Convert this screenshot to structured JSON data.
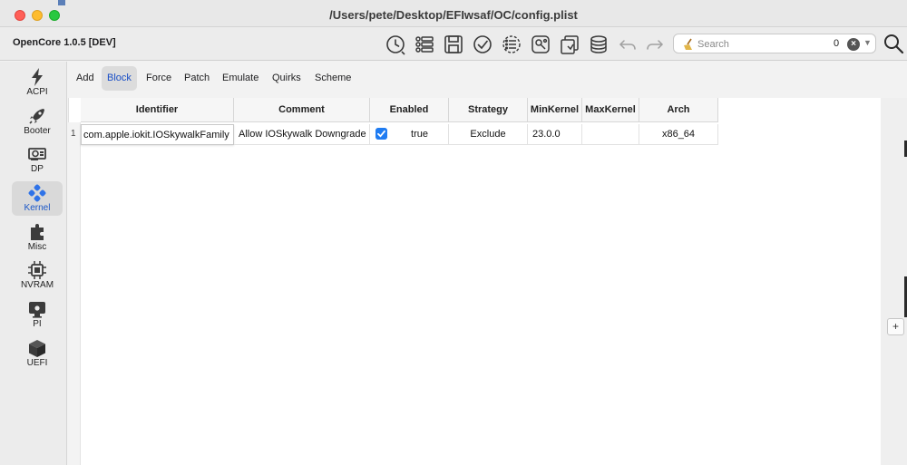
{
  "window": {
    "title": "/Users/pete/Desktop/EFIwsaf/OC/config.plist",
    "app_name": "OpenCore 1.0.5 [DEV]"
  },
  "toolbar": {
    "icons": [
      "history-icon",
      "list-icon",
      "save-icon",
      "check-icon",
      "checklist-icon",
      "network-icon",
      "import-icon",
      "database-icon",
      "undo-icon",
      "redo-icon"
    ]
  },
  "search": {
    "placeholder": "Search",
    "value": "",
    "count": "0"
  },
  "sidebar": {
    "items": [
      {
        "label": "ACPI",
        "icon": "bolt-icon"
      },
      {
        "label": "Booter",
        "icon": "rocket-icon"
      },
      {
        "label": "DP",
        "icon": "gpu-card-icon"
      },
      {
        "label": "Kernel",
        "icon": "kernel-icon",
        "active": true
      },
      {
        "label": "Misc",
        "icon": "puzzle-icon"
      },
      {
        "label": "NVRAM",
        "icon": "chip-icon"
      },
      {
        "label": "PI",
        "icon": "apple-monitor-icon"
      },
      {
        "label": "UEFI",
        "icon": "cube-icon"
      }
    ]
  },
  "tabs": [
    {
      "label": "Add"
    },
    {
      "label": "Block",
      "active": true
    },
    {
      "label": "Force"
    },
    {
      "label": "Patch"
    },
    {
      "label": "Emulate"
    },
    {
      "label": "Quirks"
    },
    {
      "label": "Scheme"
    }
  ],
  "table": {
    "columns": [
      "Identifier",
      "Comment",
      "Enabled",
      "Strategy",
      "MinKernel",
      "MaxKernel",
      "Arch"
    ],
    "rows": [
      {
        "index": "1",
        "identifier": "com.apple.iokit.IOSkywalkFamily",
        "comment": "Allow IOSkywalk Downgrade",
        "enabled_checked": true,
        "enabled": "true",
        "strategy": "Exclude",
        "minkernel": "23.0.0",
        "maxkernel": "",
        "arch": "x86_64"
      }
    ],
    "add_button": "+"
  },
  "colors": {
    "accent": "#1f7cf2",
    "active_label": "#1b57c7",
    "close": "#ff5f57",
    "minimize": "#febc2e",
    "zoom": "#28c840"
  }
}
